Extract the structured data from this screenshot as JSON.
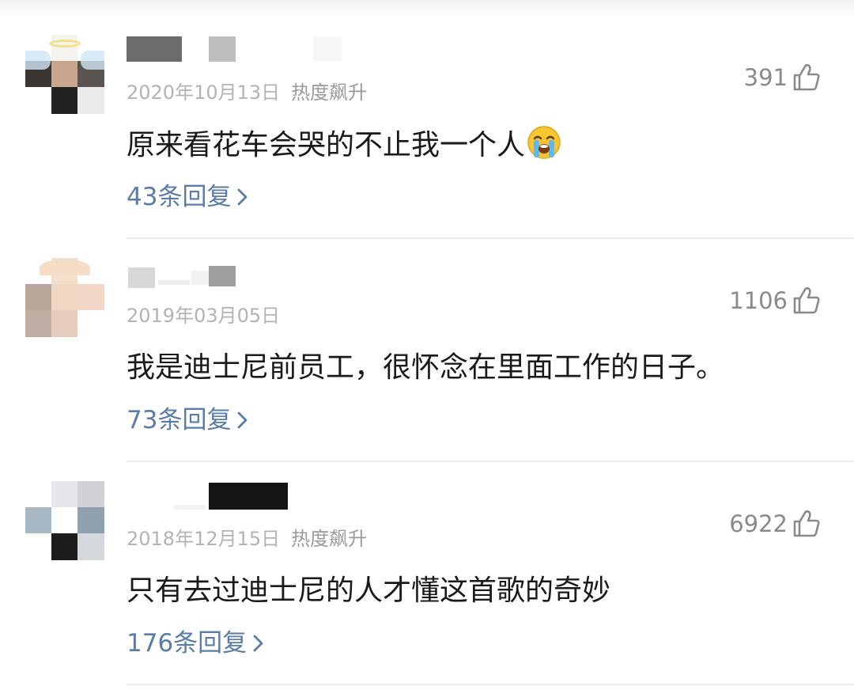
{
  "comments": [
    {
      "date": "2020年10月13日",
      "tag": "热度飙升",
      "likes": "391",
      "text": "原来看花车会哭的不止我一个人",
      "emoji": "loudly-crying-face",
      "replies": "43条回复"
    },
    {
      "date": "2019年03月05日",
      "tag": "",
      "likes": "1106",
      "text": "我是迪士尼前员工，很怀念在里面工作的日子。",
      "emoji": "",
      "replies": "73条回复"
    },
    {
      "date": "2018年12月15日",
      "tag": "热度飙升",
      "likes": "6922",
      "text": "只有去过迪士尼的人才懂这首歌的奇妙",
      "emoji": "",
      "replies": "176条回复"
    }
  ],
  "colors": {
    "reply_link": "#5a7ca8",
    "meta_text": "#b3b3b3",
    "like_count": "#8a8a8a",
    "divider": "#ececec"
  },
  "icons": {
    "like": "thumbs-up-outline-icon",
    "replies_arrow": "chevron-right-icon"
  }
}
